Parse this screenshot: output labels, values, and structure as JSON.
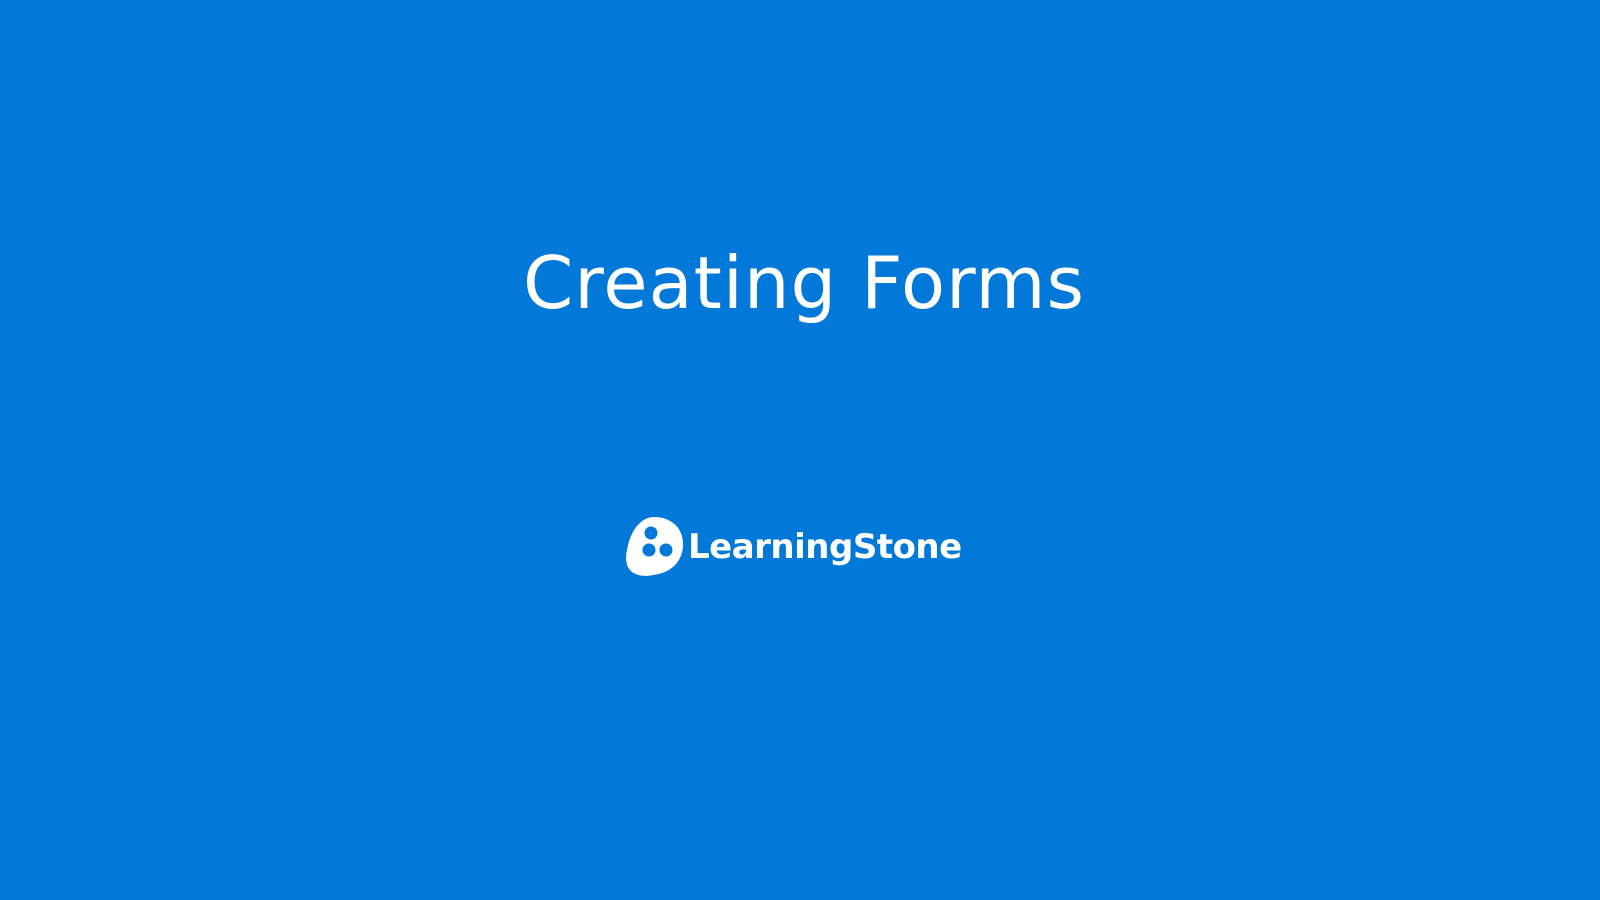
{
  "slide": {
    "title": "Creating Forms",
    "brand": {
      "name": "LearningStone",
      "logo_icon": "learningstone-logo-icon"
    }
  },
  "colors": {
    "background": "#0278d8",
    "text": "#ffffff"
  }
}
